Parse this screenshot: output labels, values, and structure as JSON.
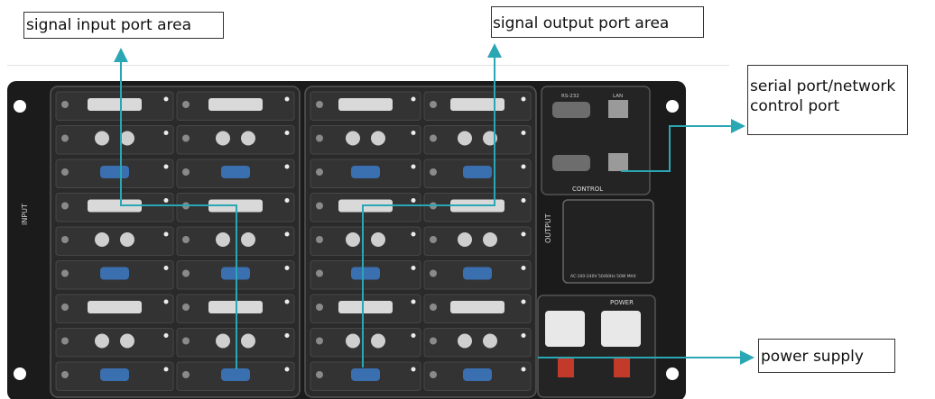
{
  "labels": {
    "input": "signal input port area",
    "output": "signal output port area",
    "serial": "serial port/network control port",
    "power": "power supply"
  },
  "chassis": {
    "left_side_text": "INPUT",
    "right_side_text": "OUTPUT",
    "control_text": "CONTROL",
    "power_text": "POWER",
    "rs232_text": "RS-232",
    "lan_text": "LAN",
    "rating_text": "AC:100-240V  50/60Hz  50W MAX"
  },
  "colors": {
    "arrow": "#2aa7b5",
    "chassis": "#1b1b1b",
    "panel": "#2a2a2a",
    "card": "#333333",
    "port_blue": "#3a6fb0",
    "power_red": "#c23a2a"
  }
}
